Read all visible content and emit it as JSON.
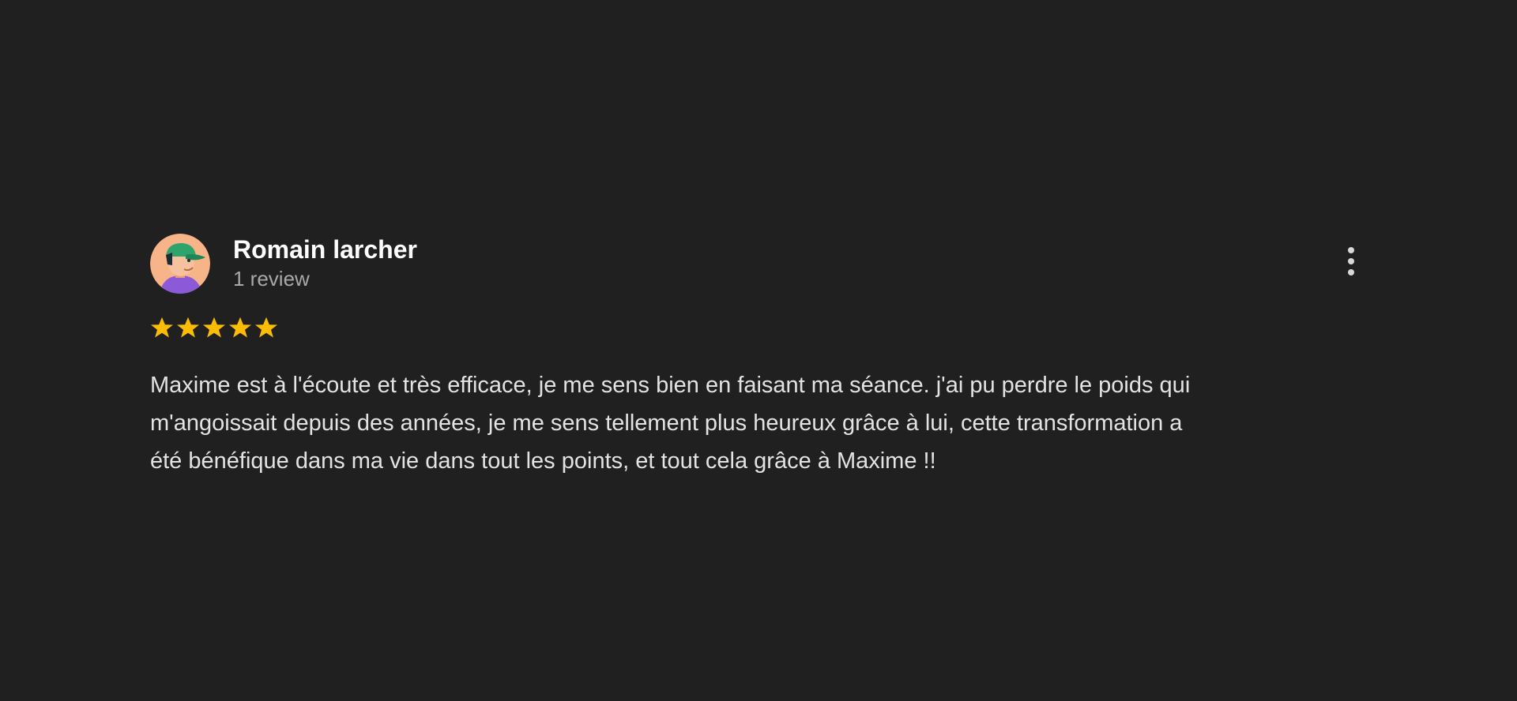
{
  "review": {
    "reviewer_name": "Romain larcher",
    "review_count": "1 review",
    "rating": 5,
    "rating_max": 5,
    "text": "Maxime est à l'écoute et très efficace, je me sens bien en faisant ma séance. j'ai pu perdre le poids qui\nm'angoissait depuis des années, je me sens tellement plus heureux grâce à lui, cette transformation a\nété bénéfique dans ma vie dans tout les points, et tout cela grâce à Maxime !!"
  },
  "icons": {
    "avatar": "avatar-cap-icon",
    "menu": "more-vertical-icon",
    "star": "star-icon"
  },
  "colors": {
    "background": "#202020",
    "name": "#ffffff",
    "secondary_text": "#a8a8a8",
    "body_text": "#e3e3e3",
    "star": "#fbbc04",
    "menu_dots": "#d8d8d8",
    "avatar_bg": "#f8b489",
    "avatar_cap": "#2ea36b",
    "avatar_shirt": "#8c59d9"
  }
}
